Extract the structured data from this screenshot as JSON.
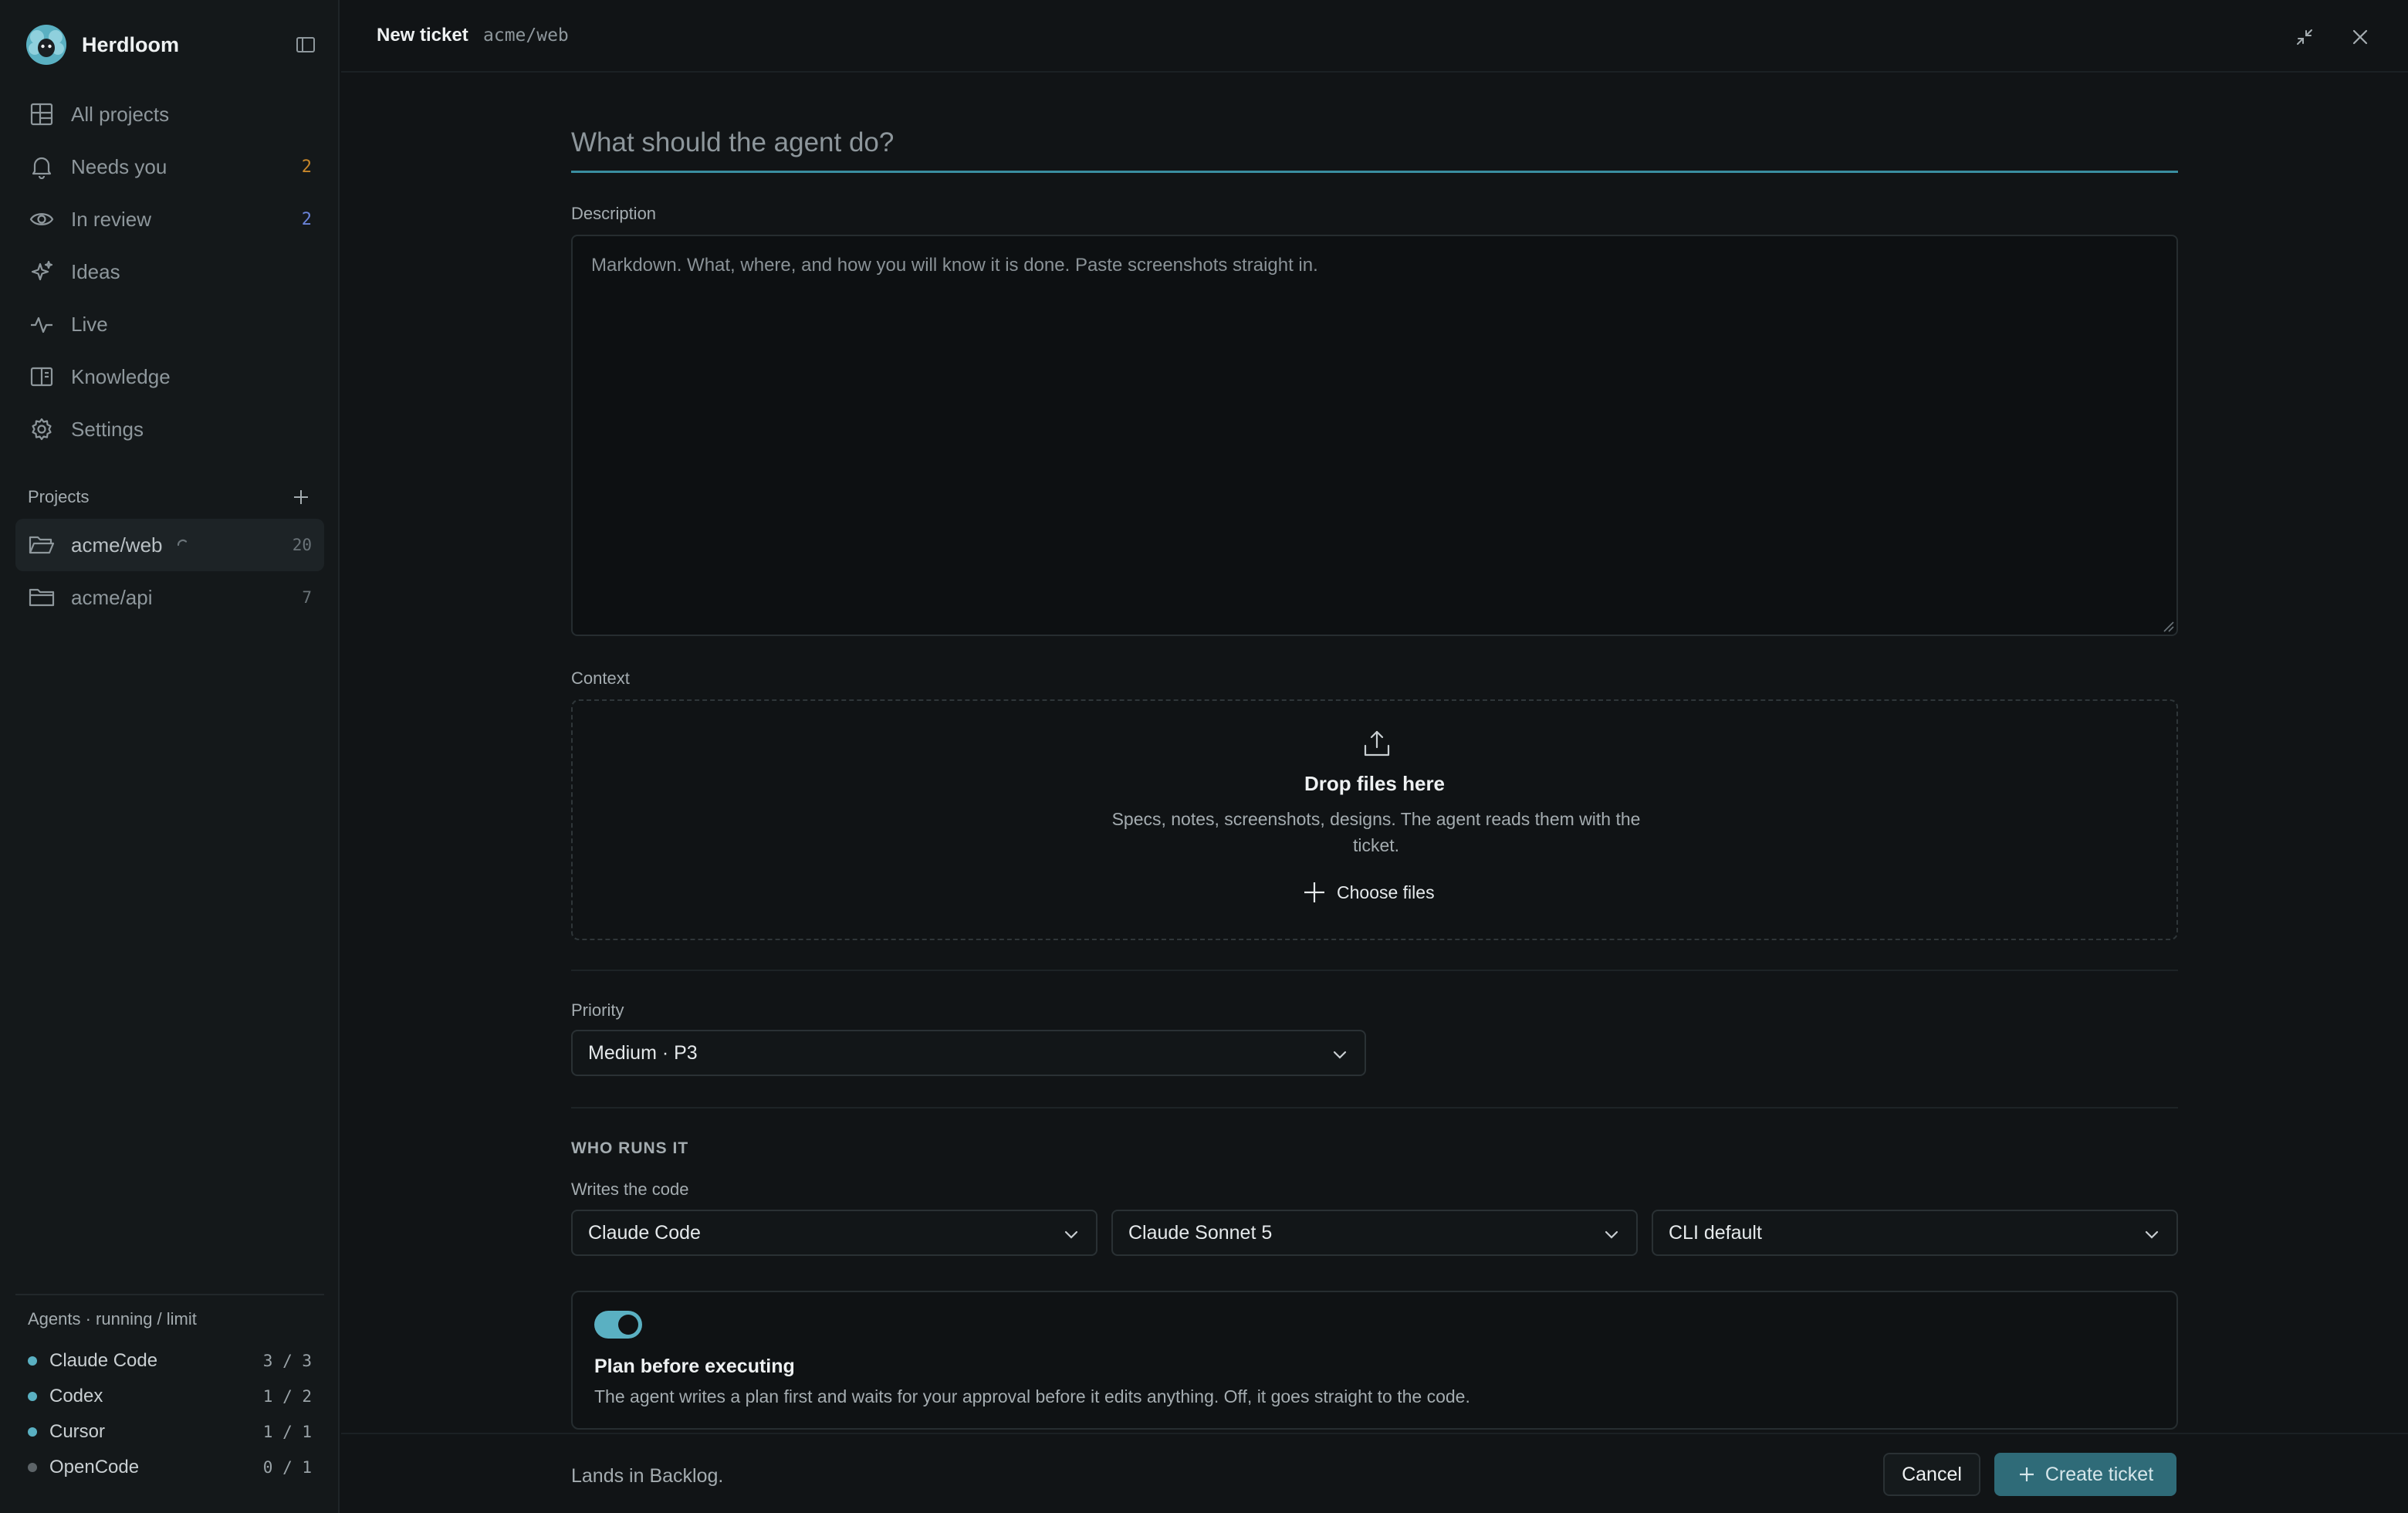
{
  "sidebar": {
    "brand_name": "Herdloom",
    "nav": [
      {
        "label": "All projects",
        "icon": "grid-icon"
      },
      {
        "label": "Needs you",
        "icon": "bell-icon",
        "count": "2",
        "count_color": "#c7862a"
      },
      {
        "label": "In review",
        "icon": "eye-icon",
        "count": "2",
        "count_color": "#6a83d8"
      },
      {
        "label": "Ideas",
        "icon": "sparkle-icon"
      },
      {
        "label": "Live",
        "icon": "activity-icon"
      },
      {
        "label": "Knowledge",
        "icon": "book-icon"
      },
      {
        "label": "Settings",
        "icon": "gear-icon"
      }
    ],
    "projects_title": "Projects",
    "projects": [
      {
        "label": "acme/web",
        "count": "20",
        "active": true
      },
      {
        "label": "acme/api",
        "count": "7",
        "active": false
      }
    ],
    "agents_title": "Agents · running / limit",
    "agents": [
      {
        "name": "Claude Code",
        "usage": "3 / 3",
        "dot_color": "#5ab0c2"
      },
      {
        "name": "Codex",
        "usage": "1 / 2",
        "dot_color": "#5ab0c2"
      },
      {
        "name": "Cursor",
        "usage": "1 / 1",
        "dot_color": "#5ab0c2"
      },
      {
        "name": "OpenCode",
        "usage": "0 / 1",
        "dot_color": "#5d6468"
      }
    ]
  },
  "topbar": {
    "title": "New ticket",
    "repo": "acme/web"
  },
  "form": {
    "title_placeholder": "What should the agent do?",
    "description_label": "Description",
    "description_placeholder": "Markdown. What, where, and how you will know it is done. Paste screenshots straight in.",
    "context_label": "Context",
    "dropzone_title": "Drop files here",
    "dropzone_subtitle": "Specs, notes, screenshots, designs. The agent reads them with the ticket.",
    "choose_files_label": "Choose files",
    "priority_label": "Priority",
    "priority_value": "Medium · P3",
    "who_runs_label": "WHO RUNS IT",
    "writes_code_label": "Writes the code",
    "agent_value": "Claude Code",
    "model_value": "Claude Sonnet 5",
    "effort_value": "CLI default",
    "plan_title": "Plan before executing",
    "plan_description": "The agent writes a plan first and waits for your approval before it edits anything. Off, it goes straight to the code.",
    "plan_enabled": true
  },
  "footer": {
    "note": "Lands in Backlog.",
    "cancel_label": "Cancel",
    "create_label": "Create ticket"
  },
  "colors": {
    "accent": "#5ab0c2",
    "primary_button": "#2f6b78",
    "background": "#111416"
  }
}
